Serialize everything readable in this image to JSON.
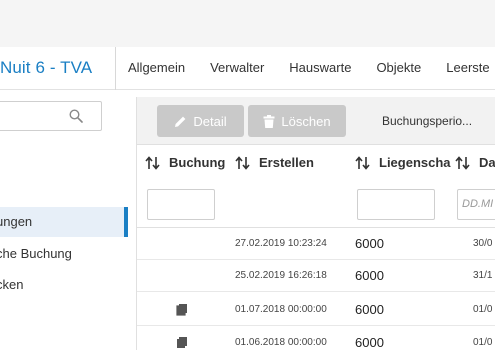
{
  "app": {
    "title": "Nuit 6 - TVA"
  },
  "tabs": [
    "Allgemein",
    "Verwalter",
    "Hauswarte",
    "Objekte",
    "Leerste"
  ],
  "sidebar": {
    "search": {
      "placeholder": ""
    },
    "items": [
      {
        "label": "ungen",
        "active": true
      },
      {
        "label": "che Buchung",
        "active": false
      },
      {
        "label": "cken",
        "active": false
      }
    ]
  },
  "toolbar": {
    "detail_label": "Detail",
    "delete_label": "Löschen",
    "period_label": "Buchungsperio..."
  },
  "table": {
    "columns": [
      "Buchung",
      "Erstellen",
      "Liegenscha",
      "Da"
    ],
    "filters": {
      "date_placeholder": "DD.MI"
    },
    "rows": [
      {
        "has_icon": false,
        "created": "27.02.2019 10:23:24",
        "property": "6000",
        "date": "30/0"
      },
      {
        "has_icon": false,
        "created": "25.02.2019 16:26:18",
        "property": "6000",
        "date": "31/1"
      },
      {
        "has_icon": true,
        "created": "01.07.2018 00:00:00",
        "property": "6000",
        "date": "01/0"
      },
      {
        "has_icon": true,
        "created": "01.06.2018 00:00:00",
        "property": "6000",
        "date": "01/0"
      }
    ]
  },
  "colors": {
    "accent": "#1a7fc4",
    "button_disabled": "#c9c9c9"
  }
}
